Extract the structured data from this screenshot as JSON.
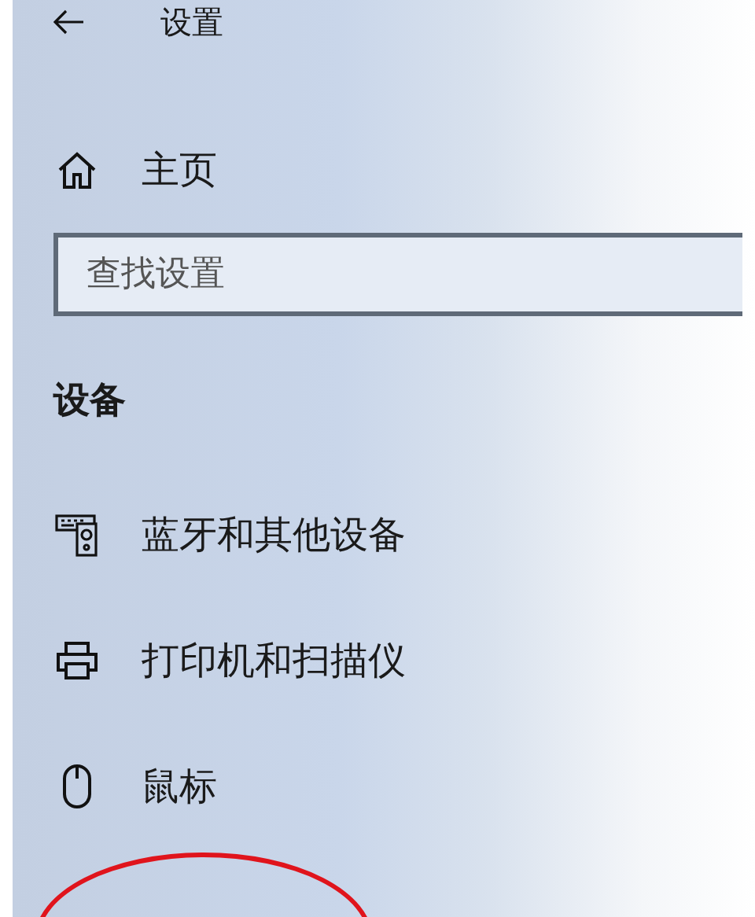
{
  "window": {
    "title": "设置"
  },
  "nav": [
    {
      "kind": "home",
      "label": "主页"
    }
  ],
  "search": {
    "placeholder": "查找设置"
  },
  "section": {
    "heading": "设备"
  },
  "items": [
    {
      "kind": "bluetooth",
      "label": "蓝牙和其他设备"
    },
    {
      "kind": "printer",
      "label": "打印机和扫描仪"
    },
    {
      "kind": "mouse",
      "label": "鼠标"
    }
  ]
}
